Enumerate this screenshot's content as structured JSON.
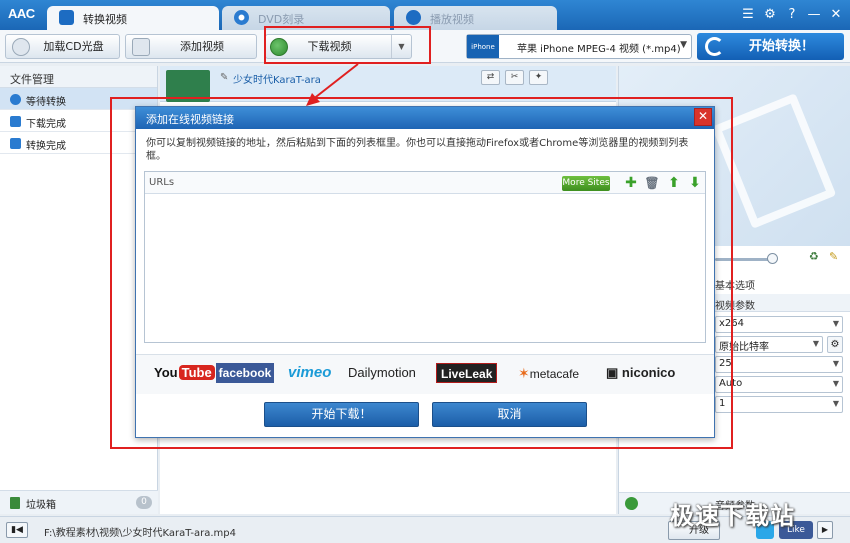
{
  "app": {
    "logo": "AAC"
  },
  "tabs": [
    {
      "label": "转换视频",
      "active": true
    },
    {
      "label": "DVD刻录",
      "active": false
    },
    {
      "label": "播放视频",
      "active": false
    }
  ],
  "window_buttons": {
    "menu": "☰",
    "settings": "⚙",
    "help": "?",
    "minimize": "—",
    "close": "✕"
  },
  "toolbar": {
    "load_cd_label": "加载CD光盘",
    "add_video_label": "添加视频",
    "download_video_label": "下载视频",
    "format_icon_text": "iPhone",
    "format_value": "苹果 iPhone MPEG-4 视频 (*.mp4)",
    "start_label": "开始转换！"
  },
  "sidebar": {
    "header": "文件管理",
    "items": [
      {
        "label": "等待转换"
      },
      {
        "label": "下载完成"
      },
      {
        "label": "转换完成"
      }
    ],
    "trash_label": "垃圾箱",
    "trash_count": "0"
  },
  "file_row": {
    "name": "少女时代KaraT-ara"
  },
  "right_panel": {
    "basic_options": "基本选项",
    "video_params": "视频参数",
    "codec": "x264",
    "bitrate": "原始比特率",
    "framerate": "25",
    "resolution": "Auto",
    "aspect": "1",
    "audio_params": "音频参数"
  },
  "dialog": {
    "title": "添加在线视频链接",
    "description": "你可以复制视频链接的地址，然后粘贴到下面的列表框里。你也可以直接拖动Firefox或者Chrome等浏览器里的视频到列表框。",
    "urls_label": "URLs",
    "more_sites_label": "More Sites",
    "sites": {
      "you": "You",
      "tube": "Tube",
      "facebook": "facebook",
      "vimeo": "vimeo",
      "dailymotion": "Dailymotion",
      "liveleak": "LiveLeak",
      "metacafe": "metacafe",
      "niconico": "niconico"
    },
    "start_download_label": "开始下载！",
    "cancel_label": "取消"
  },
  "statusbar": {
    "path": "F:\\教程素材\\视频\\少女时代KaraT-ara.mp4",
    "upgrade_label": "升级",
    "facebook_like": "Like"
  },
  "watermark": "极速下载站",
  "colors": {
    "accent": "#1d6cc2",
    "annotation": "#e02020"
  }
}
